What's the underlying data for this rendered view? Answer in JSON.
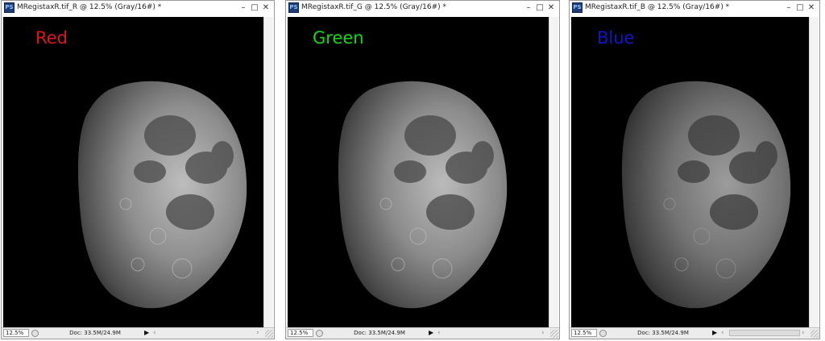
{
  "windows": [
    {
      "id": "r",
      "title": "MRegistaxR.tif_R @ 12.5% (Gray/16#) *",
      "channel_label": "Red",
      "label_color": "#e0141e",
      "zoom": "12.5%",
      "doc_info": "Doc: 33.5M/24.9M"
    },
    {
      "id": "g",
      "title": "MRegistaxR.tif_G @ 12.5% (Gray/16#) *",
      "channel_label": "Green",
      "label_color": "#17d617",
      "zoom": "12.5%",
      "doc_info": "Doc: 33.5M/24.9M"
    },
    {
      "id": "b",
      "title": "MRegistaxR.tif_B @ 12.5% (Gray/16#) *",
      "channel_label": "Blue",
      "label_color": "#1414c8",
      "zoom": "12.5%",
      "doc_info": "Doc: 33.5M/24.9M"
    }
  ],
  "app_icon": "PS",
  "icons": {
    "app": "photoshop-icon",
    "minimize": "minimize-icon",
    "maximize": "maximize-icon",
    "close": "close-icon",
    "zoom": "zoom-icon",
    "menu_arrow": "triangle-right-icon"
  },
  "colors": {
    "canvas_background": "#000000",
    "window_frame": "#9a9a9a",
    "moon_brightness": {
      "r": 0.68,
      "g": 0.66,
      "b": 0.52
    }
  }
}
